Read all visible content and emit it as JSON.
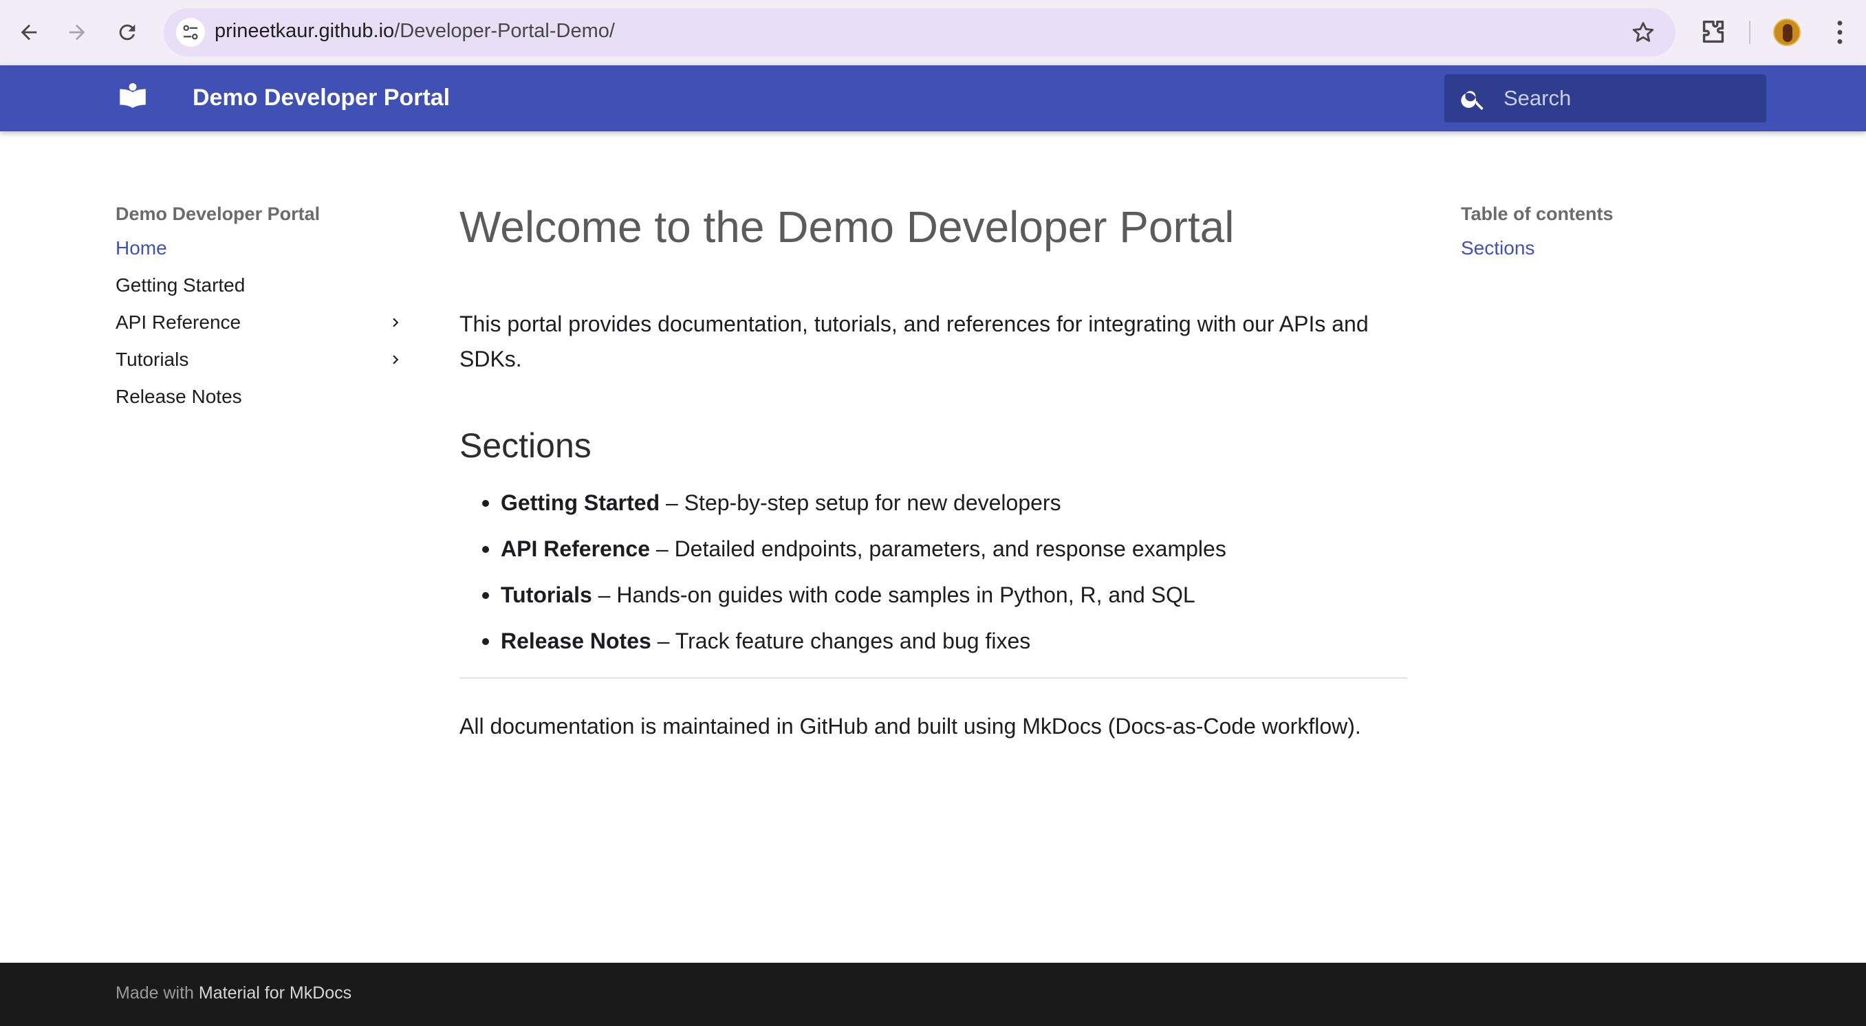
{
  "browser": {
    "url_host": "prineetkaur.github.io",
    "url_path": "/Developer-Portal-Demo/",
    "icons": [
      "back-icon",
      "forward-icon",
      "reload-icon",
      "site-info-icon",
      "star-icon",
      "extensions-icon",
      "profile-avatar",
      "menu-icon"
    ]
  },
  "header": {
    "title": "Demo Developer Portal",
    "search_placeholder": "Search",
    "colors": {
      "primary": "#4051b5",
      "search_bg": "#2f3d8f"
    }
  },
  "sidebar": {
    "title": "Demo Developer Portal",
    "items": [
      {
        "label": "Home",
        "active": true,
        "expandable": false
      },
      {
        "label": "Getting Started",
        "active": false,
        "expandable": false
      },
      {
        "label": "API Reference",
        "active": false,
        "expandable": true
      },
      {
        "label": "Tutorials",
        "active": false,
        "expandable": true
      },
      {
        "label": "Release Notes",
        "active": false,
        "expandable": false
      }
    ]
  },
  "main": {
    "title": "Welcome to the Demo Developer Portal",
    "intro": "This portal provides documentation, tutorials, and references for integrating with our APIs and SDKs.",
    "section_heading": "Sections",
    "sections": [
      {
        "name": "Getting Started",
        "desc": " – Step-by-step setup for new developers"
      },
      {
        "name": "API Reference",
        "desc": " – Detailed endpoints, parameters, and response examples"
      },
      {
        "name": "Tutorials",
        "desc": " – Hands-on guides with code samples in Python, R, and SQL"
      },
      {
        "name": "Release Notes",
        "desc": " – Track feature changes and bug fixes"
      }
    ],
    "footer_note": "All documentation is maintained in GitHub and built using MkDocs (Docs-as-Code workflow)."
  },
  "toc": {
    "title": "Table of contents",
    "items": [
      {
        "label": "Sections"
      }
    ]
  },
  "footer": {
    "made_with": "Made with",
    "link_text": "Material for MkDocs"
  }
}
